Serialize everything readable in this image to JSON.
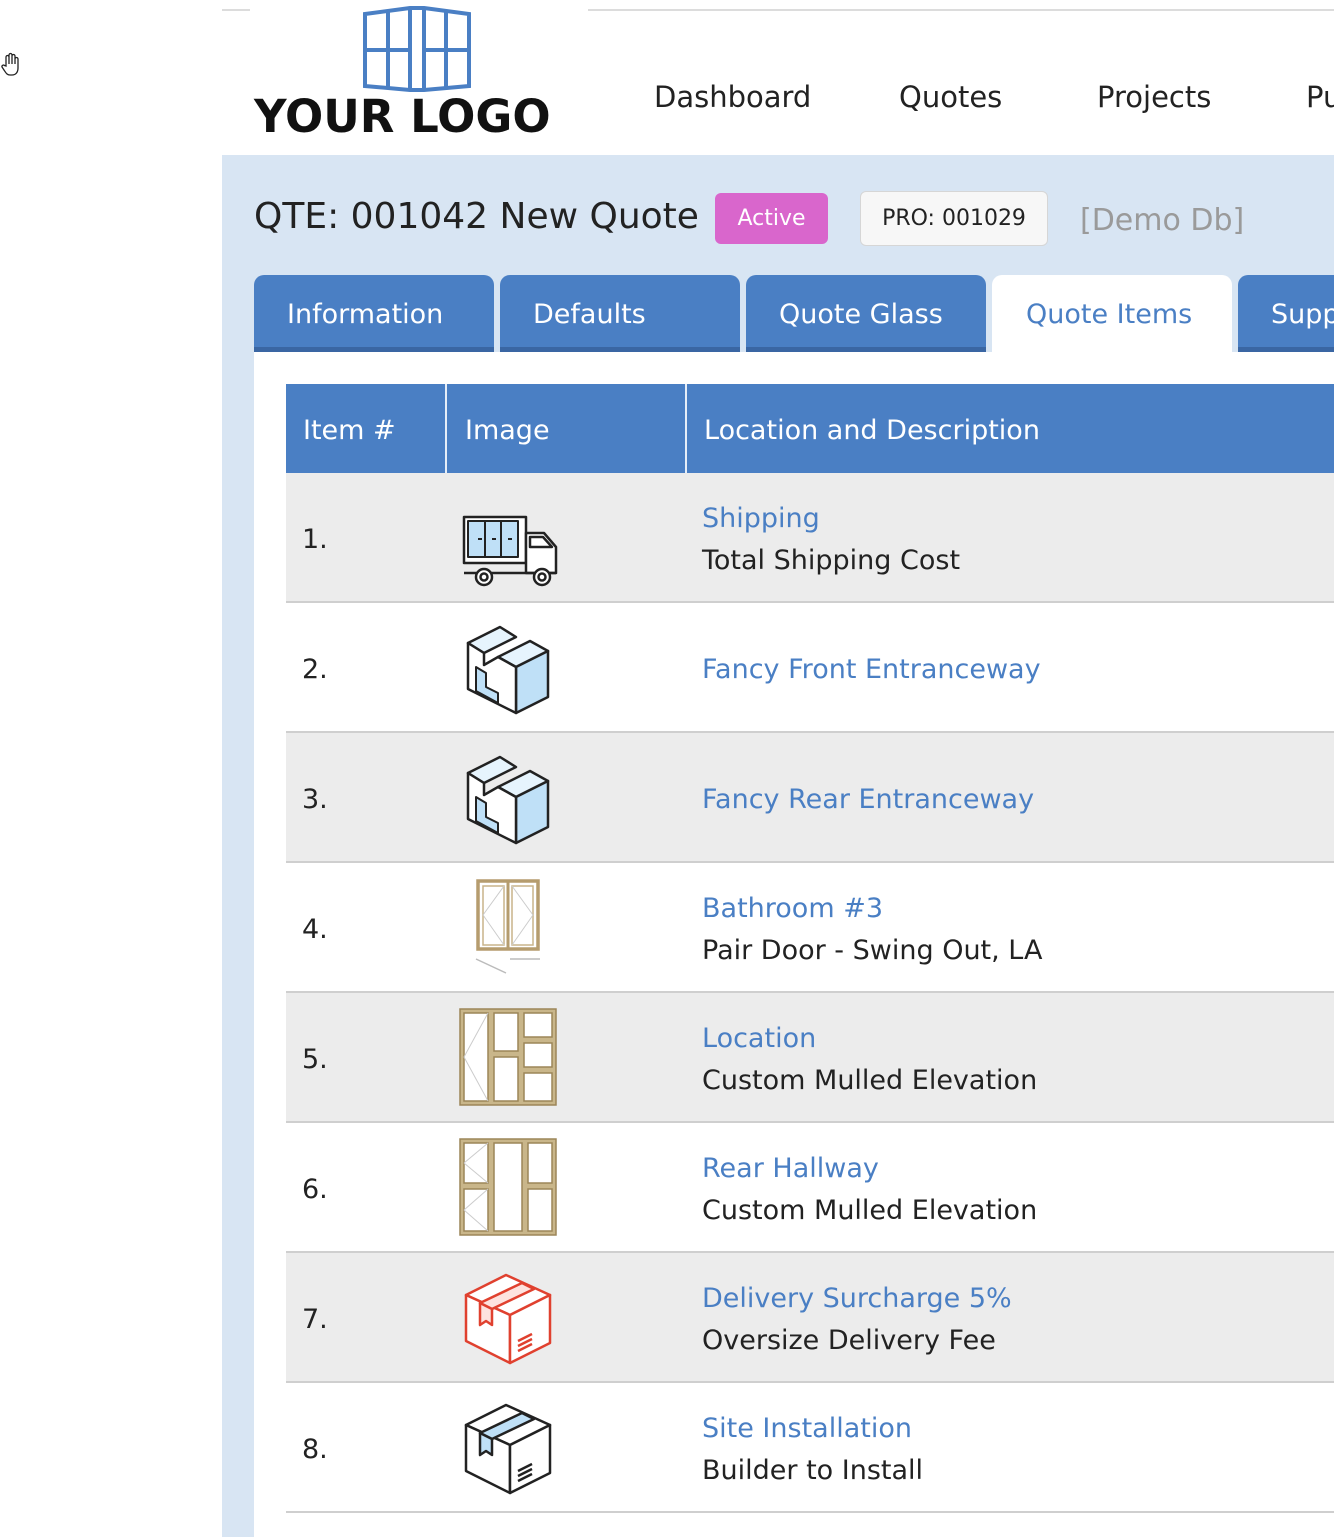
{
  "logo": {
    "text": "YOUR LOGO"
  },
  "nav": {
    "items": [
      "Dashboard",
      "Quotes",
      "Projects",
      "Pu"
    ]
  },
  "header": {
    "title": "QTE: 001042 New Quote",
    "status": "Active",
    "project_button": "PRO: 001029",
    "db_label": "[Demo Db]"
  },
  "tabs": [
    {
      "label": "Information",
      "active": false
    },
    {
      "label": "Defaults",
      "active": false
    },
    {
      "label": "Quote Glass",
      "active": false
    },
    {
      "label": "Quote Items",
      "active": true
    },
    {
      "label": "Suppl",
      "active": false
    }
  ],
  "table": {
    "columns": [
      "Item #",
      "Image",
      "Location and Description"
    ],
    "rows": [
      {
        "num": "1.",
        "icon": "truck-icon",
        "location": "Shipping",
        "description": "Total Shipping Cost"
      },
      {
        "num": "2.",
        "icon": "entranceway-icon",
        "location": "Fancy Front Entranceway",
        "description": ""
      },
      {
        "num": "3.",
        "icon": "entranceway-icon",
        "location": "Fancy Rear Entranceway",
        "description": ""
      },
      {
        "num": "4.",
        "icon": "pair-door-icon",
        "location": "Bathroom #3",
        "description": "Pair Door - Swing Out, LA"
      },
      {
        "num": "5.",
        "icon": "mulled-elevation-icon",
        "location": "Location",
        "description": "Custom Mulled Elevation"
      },
      {
        "num": "6.",
        "icon": "mulled-elevation-icon",
        "location": "Rear Hallway",
        "description": "Custom Mulled Elevation"
      },
      {
        "num": "7.",
        "icon": "red-box-icon",
        "location": "Delivery Surcharge 5%",
        "description": "Oversize Delivery Fee"
      },
      {
        "num": "8.",
        "icon": "box-icon",
        "location": "Site Installation",
        "description": "Builder to Install"
      }
    ]
  },
  "colors": {
    "accent": "#4a7fc4",
    "background": "#d8e5f3",
    "status_badge": "#d966cc",
    "delivery_icon": "#e0412f",
    "frame": "#b59c6e"
  }
}
